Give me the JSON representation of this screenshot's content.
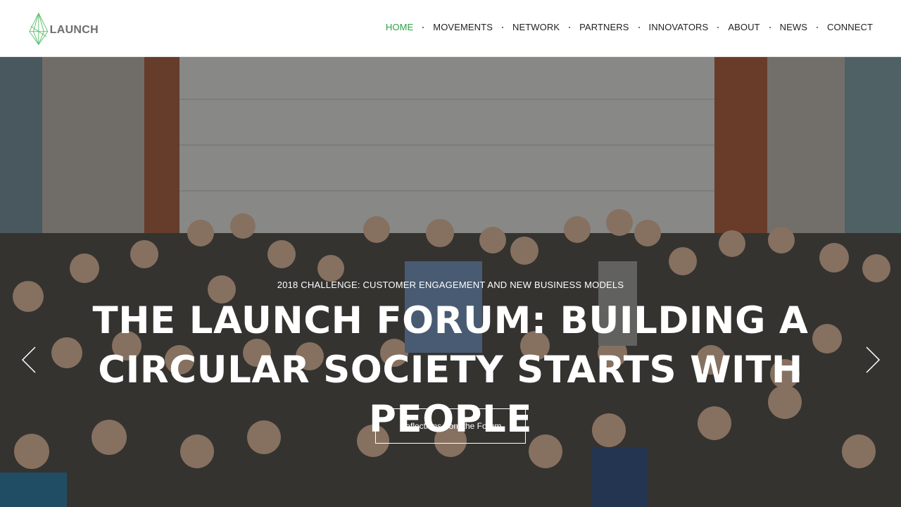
{
  "brand": {
    "name": "LAUNCH"
  },
  "nav": {
    "items": [
      {
        "label": "HOME",
        "active": true
      },
      {
        "label": "MOVEMENTS"
      },
      {
        "label": "NETWORK"
      },
      {
        "label": "PARTNERS"
      },
      {
        "label": "INNOVATORS"
      },
      {
        "label": "ABOUT"
      },
      {
        "label": "NEWS"
      },
      {
        "label": "CONNECT"
      }
    ]
  },
  "hero": {
    "eyebrow": "2018 CHALLENGE: CUSTOMER ENGAGEMENT AND NEW BUSINESS MODELS",
    "title_line1": "THE LAUNCH FORUM: BUILDING A",
    "title_line2": "CIRCULAR SOCIETY STARTS WITH PEOPLE",
    "cta": "Reflections from the Forum",
    "prev_icon": "chevron-left-icon",
    "next_icon": "chevron-right-icon"
  },
  "colors": {
    "accent": "#2ea043",
    "text": "#222222",
    "logo_text": "#6d6d6d"
  }
}
